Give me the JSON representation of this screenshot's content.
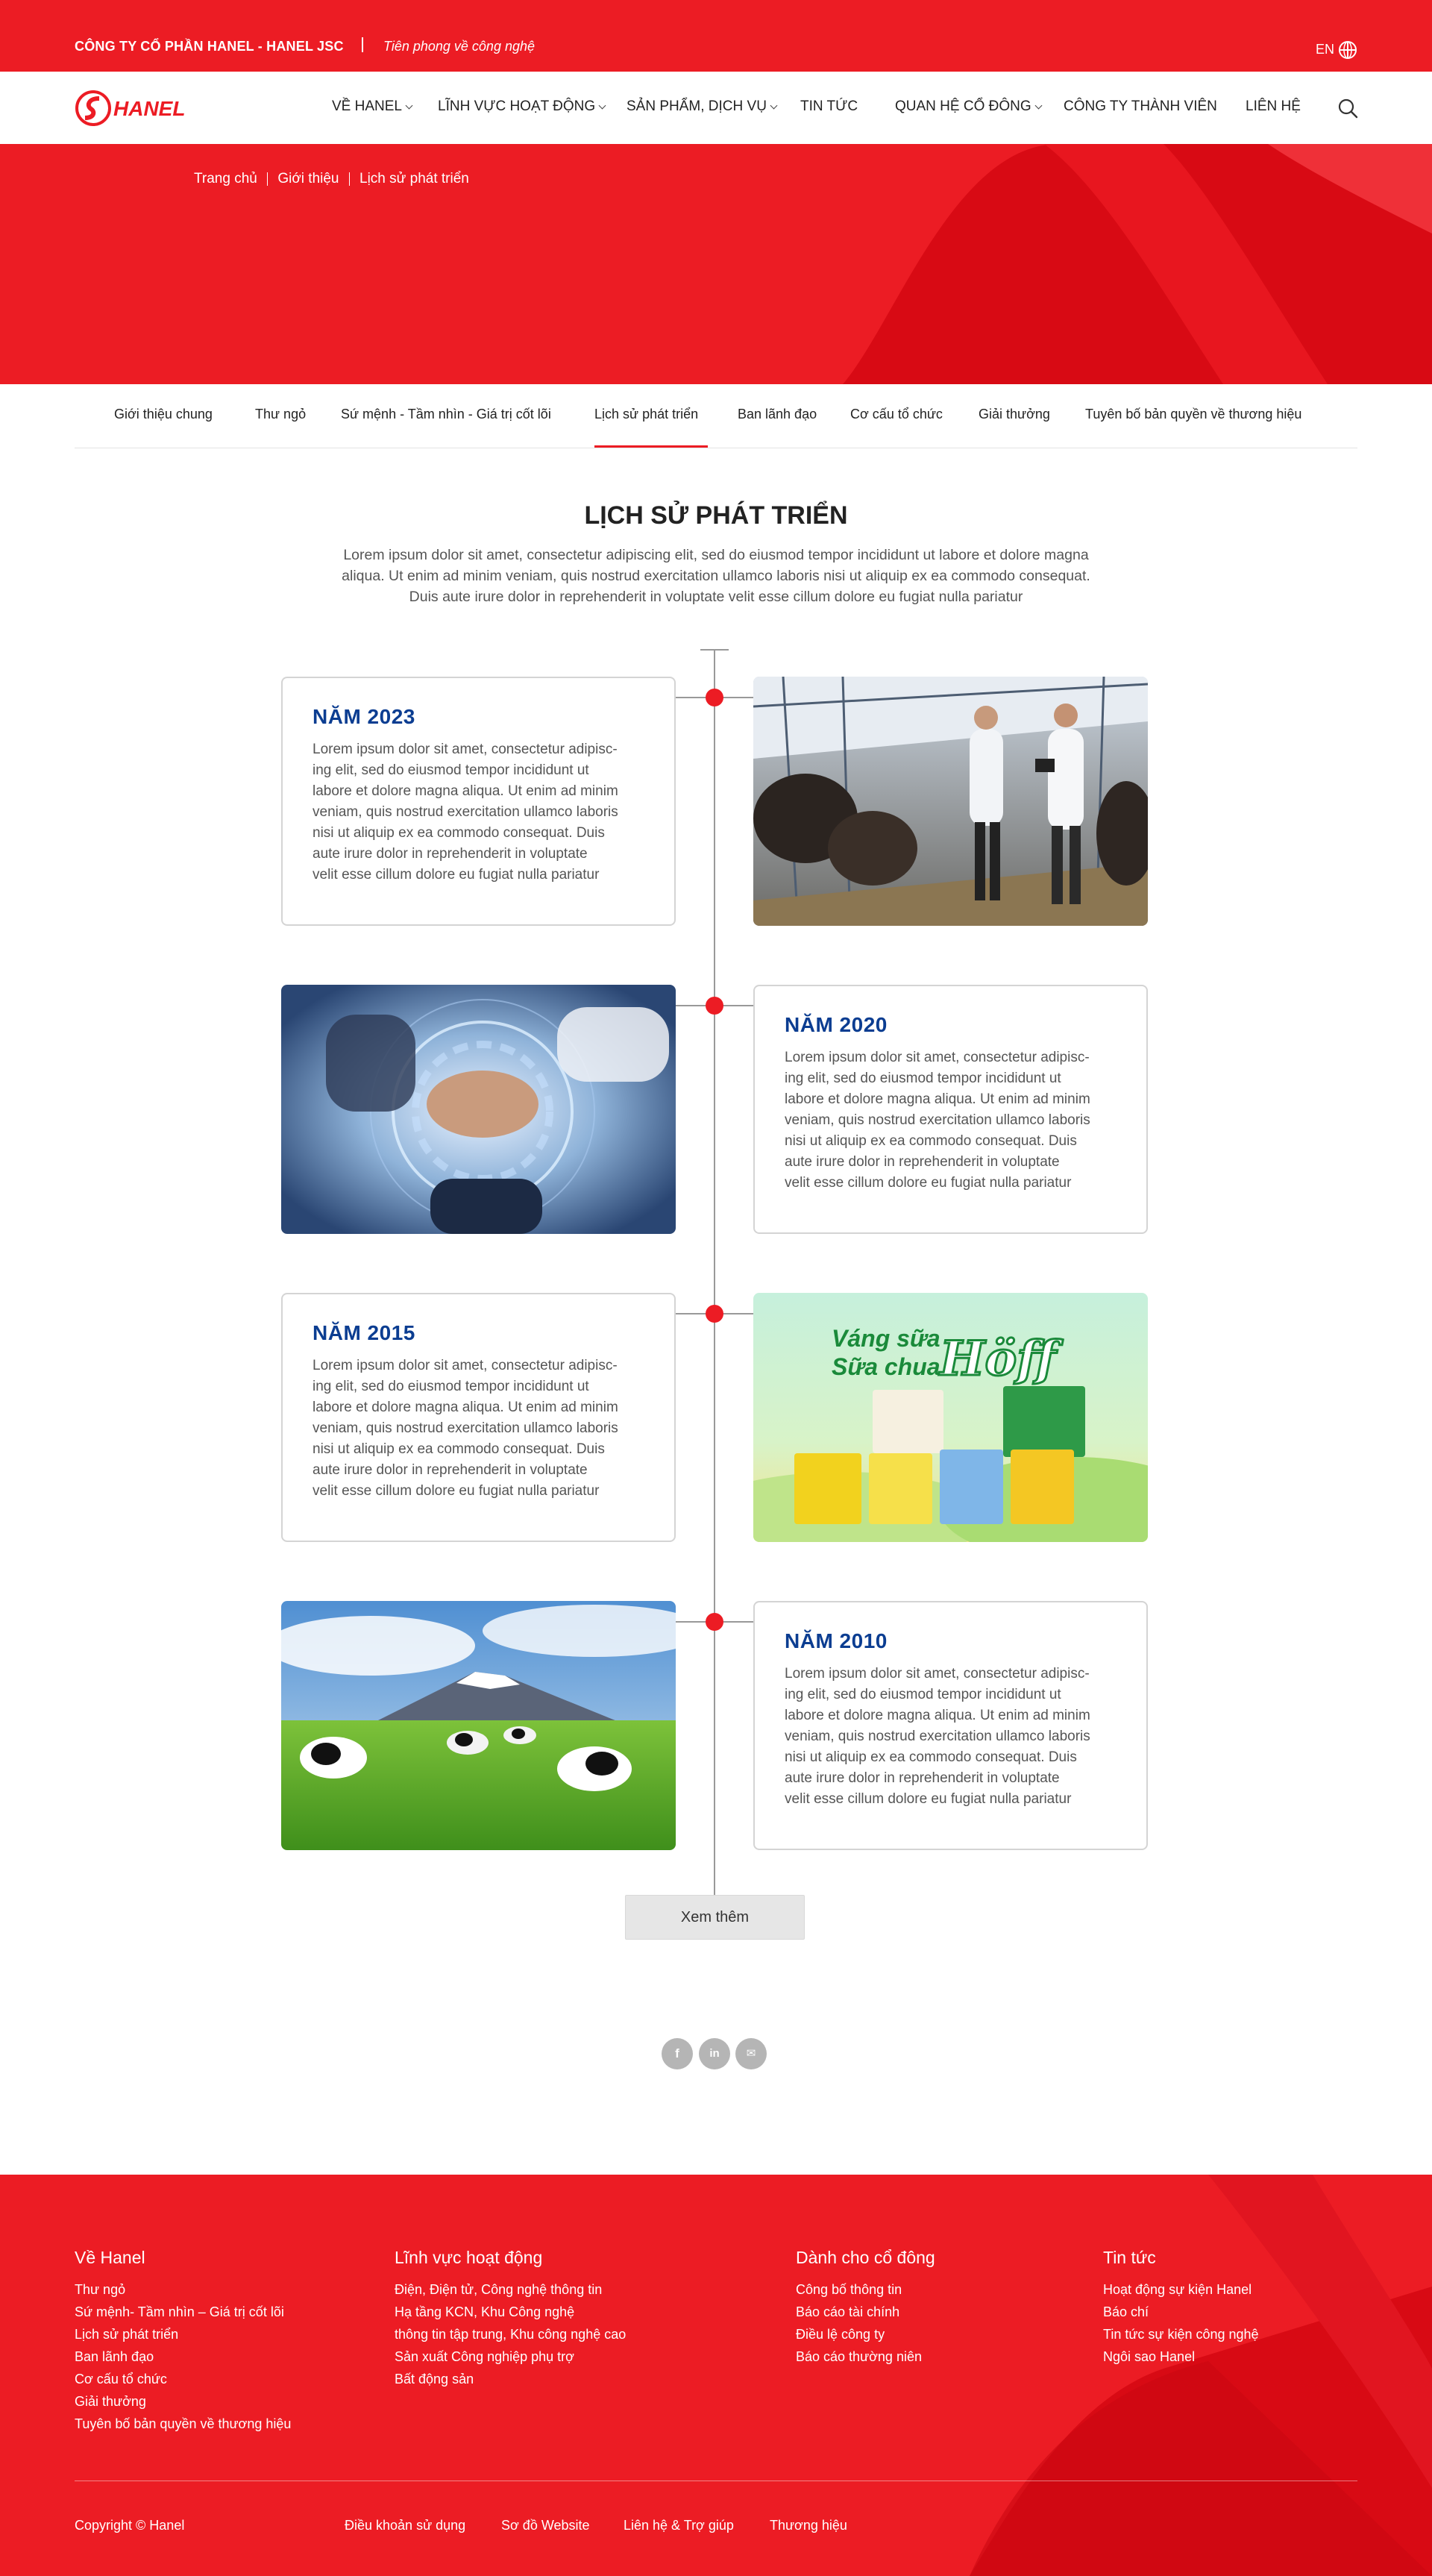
{
  "topbar": {
    "company": "CÔNG TY CỔ PHẦN HANEL - HANEL JSC",
    "slogan": "Tiên phong về công nghệ",
    "lang": "EN",
    "globe_icon": "globe-icon"
  },
  "brand": {
    "logo_text": "HANEL",
    "red": "#ec1c24",
    "dark_red": "#c8000a",
    "year_blue": "#0b3d91"
  },
  "menu": [
    {
      "label": "VỀ HANEL",
      "dropdown": true
    },
    {
      "label": "LĨNH VỰC HOẠT ĐỘNG",
      "dropdown": true
    },
    {
      "label": "SẢN PHẨM, DỊCH VỤ",
      "dropdown": true
    },
    {
      "label": "TIN TỨC",
      "dropdown": false
    },
    {
      "label": "QUAN HỆ CỔ ĐÔNG",
      "dropdown": true
    },
    {
      "label": "CÔNG TY THÀNH VIÊN",
      "dropdown": false
    },
    {
      "label": "LIÊN HỆ",
      "dropdown": false
    }
  ],
  "breadcrumb": [
    "Trang chủ",
    "Giới thiệu",
    "Lịch sử phát triển"
  ],
  "subnav": [
    "Giới thiệu chung",
    "Thư ngỏ",
    "Sứ mệnh - Tầm nhìn - Giá trị cốt lõi",
    "Lịch sử phát triển",
    "Ban lãnh đạo",
    "Cơ cấu tổ chức",
    "Giải thưởng",
    "Tuyên bố bản quyền về thương hiệu"
  ],
  "subnav_active": "Lịch sử phát triển",
  "section": {
    "title": "LỊCH SỬ PHÁT TRIỂN",
    "intro": [
      "Lorem ipsum dolor sit amet, consectetur adipiscing elit, sed do eiusmod tempor incididunt ut labore et dolore magna",
      "aliqua. Ut enim ad minim veniam, quis nostrud exercitation ullamco laboris nisi ut aliquip ex ea commodo consequat.",
      "Duis aute irure dolor in reprehenderit in voluptate velit esse cillum dolore eu fugiat nulla pariatur"
    ]
  },
  "timeline": [
    {
      "year": "NĂM 2023",
      "lines": [
        "Lorem ipsum dolor sit amet, consectetur adipisc-",
        "ing elit, sed do eiusmod tempor incididunt ut",
        "labore et dolore magna aliqua. Ut enim ad minim",
        "veniam, quis nostrud exercitation ullamco laboris",
        "nisi ut aliquip ex ea commodo consequat. Duis",
        "aute irure dolor in reprehenderit in voluptate",
        "velit esse cillum dolore eu fugiat nulla pariatur"
      ],
      "image": "dairy-farm-photo"
    },
    {
      "year": "NĂM 2020",
      "lines": [
        "Lorem ipsum dolor sit amet, consectetur adipisc-",
        "ing elit, sed do eiusmod tempor incididunt ut",
        "labore et dolore magna aliqua. Ut enim ad minim",
        "veniam, quis nostrud exercitation ullamco laboris",
        "nisi ut aliquip ex ea commodo consequat. Duis",
        "aute irure dolor in reprehenderit in voluptate",
        "velit esse cillum dolore eu fugiat nulla pariatur"
      ],
      "image": "teamwork-hands-photo"
    },
    {
      "year": "NĂM 2015",
      "lines": [
        "Lorem ipsum dolor sit amet, consectetur adipisc-",
        "ing elit, sed do eiusmod tempor incididunt ut",
        "labore et dolore magna aliqua. Ut enim ad minim",
        "veniam, quis nostrud exercitation ullamco laboris",
        "nisi ut aliquip ex ea commodo consequat. Duis",
        "aute irure dolor in reprehenderit in voluptate",
        "velit esse cillum dolore eu fugiat nulla pariatur"
      ],
      "image": "hoff-product-ad"
    },
    {
      "year": "NĂM 2010",
      "lines": [
        "Lorem ipsum dolor sit amet, consectetur adipisc-",
        "ing elit, sed do eiusmod tempor incididunt ut",
        "labore et dolore magna aliqua. Ut enim ad minim",
        "veniam, quis nostrud exercitation ullamco laboris",
        "nisi ut aliquip ex ea commodo consequat. Duis",
        "aute irure dolor in reprehenderit in voluptate",
        "velit esse cillum dolore eu fugiat nulla pariatur"
      ],
      "image": "cows-pasture-photo"
    }
  ],
  "product_ad": {
    "line1": "Váng sữa",
    "line2": "Sữa chua",
    "brand": "Höff"
  },
  "load_more": "Xem thêm",
  "social": [
    {
      "icon": "facebook-icon",
      "glyph": "f"
    },
    {
      "icon": "linkedin-icon",
      "glyph": "in"
    },
    {
      "icon": "mail-icon",
      "glyph": "✉"
    }
  ],
  "footer": {
    "columns": [
      {
        "title": "Về Hanel",
        "links": [
          "Thư ngỏ",
          "Sứ mệnh- Tầm nhìn – Giá trị cốt lõi",
          "Lịch sử phát triển",
          "Ban lãnh đạo",
          "Cơ cấu tổ chức",
          "Giải thưởng",
          "Tuyên bố bản quyền về thương hiệu"
        ]
      },
      {
        "title": "Lĩnh vực hoạt động",
        "links": [
          "Điện, Điện tử, Công nghệ thông tin",
          "Hạ tầng KCN, Khu Công nghệ",
          "thông tin tập trung, Khu công nghệ cao",
          "Sản xuất Công nghiệp phụ trợ",
          "Bất động sản"
        ]
      },
      {
        "title": "Dành cho cổ đông",
        "links": [
          "Công bố thông tin",
          "Báo cáo tài chính",
          "Điều lệ công ty",
          "Báo cáo thường niên"
        ]
      },
      {
        "title": "Tin tức",
        "links": [
          "Hoạt động sự kiện Hanel",
          "Báo chí",
          "Tin tức sự kiện công nghệ",
          "Ngôi sao Hanel"
        ]
      }
    ],
    "copyright": "Copyright © Hanel",
    "bottom_links": [
      "Điều khoản sử dụng",
      "Sơ đồ Website",
      "Liên hệ & Trợ giúp",
      "Thương hiệu"
    ]
  }
}
